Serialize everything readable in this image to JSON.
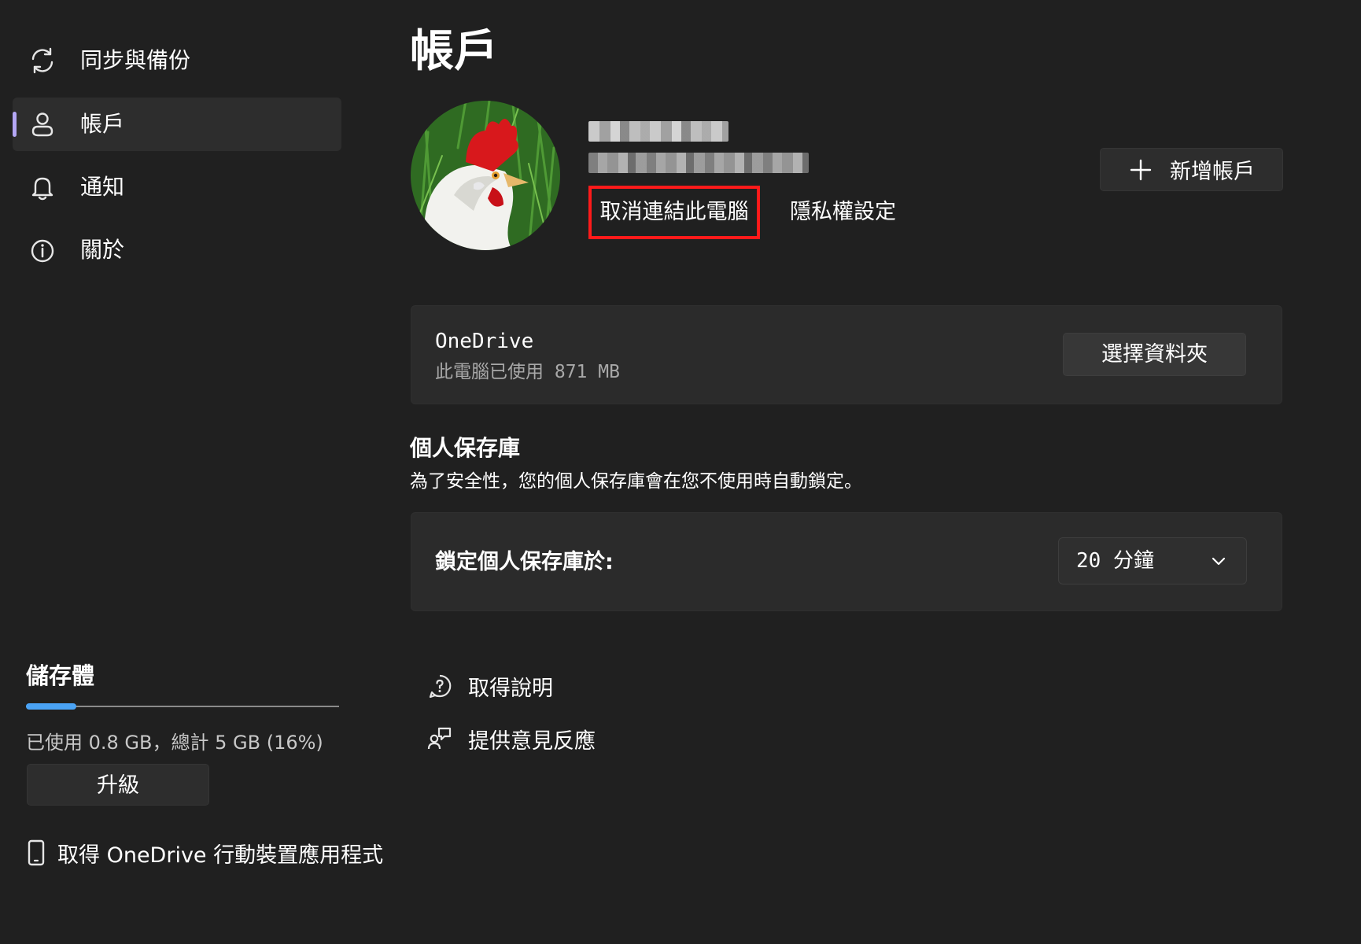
{
  "sidebar": {
    "items": [
      {
        "label": "同步與備份",
        "icon": "sync-icon",
        "active": false
      },
      {
        "label": "帳戶",
        "icon": "person-icon",
        "active": true
      },
      {
        "label": "通知",
        "icon": "bell-icon",
        "active": false
      },
      {
        "label": "關於",
        "icon": "info-icon",
        "active": false
      }
    ],
    "storage": {
      "title": "儲存體",
      "used_fraction": 0.16,
      "text": "已使用 0.8 GB，總計 5 GB (16%)",
      "upgrade_label": "升級",
      "mobile_link_label": "取得 OneDrive 行動裝置應用程式"
    }
  },
  "main": {
    "page_title": "帳戶",
    "account": {
      "unlink_label": "取消連結此電腦",
      "privacy_label": "隱私權設定",
      "add_account_label": "新增帳戶"
    },
    "onedrive_card": {
      "title": "OneDrive",
      "usage": "此電腦已使用 871 MB",
      "choose_folder_label": "選擇資料夾"
    },
    "vault": {
      "title": "個人保存庫",
      "description": "為了安全性，您的個人保存庫會在您不使用時自動鎖定。",
      "lock_label": "鎖定個人保存庫於:",
      "lock_value": "20 分鐘"
    },
    "links": {
      "help": "取得說明",
      "feedback": "提供意見反應"
    }
  },
  "colors": {
    "background": "#202020",
    "card": "#2b2b2b",
    "accent": "#4aa3f5",
    "nav_indicator": "#b4a7f5",
    "highlight_box": "#ff1a1a"
  }
}
